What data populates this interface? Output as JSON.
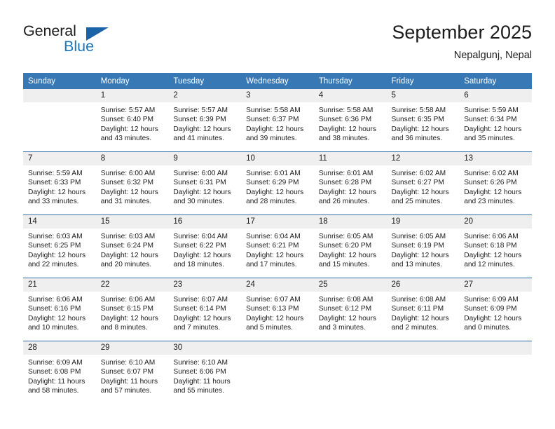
{
  "logo": {
    "text_top": "General",
    "text_bottom": "Blue",
    "triangle_color": "#1b63a8",
    "blue_color": "#1b75bb"
  },
  "header": {
    "title": "September 2025",
    "subtitle": "Nepalgunj, Nepal"
  },
  "theme": {
    "header_row_bg": "#3878b4",
    "day_number_bg": "#efefef",
    "week_divider": "#2f6eaa"
  },
  "weekday_headers": [
    "Sunday",
    "Monday",
    "Tuesday",
    "Wednesday",
    "Thursday",
    "Friday",
    "Saturday"
  ],
  "weeks": [
    [
      {
        "day": "",
        "empty": true
      },
      {
        "day": "1",
        "sunrise": "Sunrise: 5:57 AM",
        "sunset": "Sunset: 6:40 PM",
        "daylight_1": "Daylight: 12 hours",
        "daylight_2": "and 43 minutes."
      },
      {
        "day": "2",
        "sunrise": "Sunrise: 5:57 AM",
        "sunset": "Sunset: 6:39 PM",
        "daylight_1": "Daylight: 12 hours",
        "daylight_2": "and 41 minutes."
      },
      {
        "day": "3",
        "sunrise": "Sunrise: 5:58 AM",
        "sunset": "Sunset: 6:37 PM",
        "daylight_1": "Daylight: 12 hours",
        "daylight_2": "and 39 minutes."
      },
      {
        "day": "4",
        "sunrise": "Sunrise: 5:58 AM",
        "sunset": "Sunset: 6:36 PM",
        "daylight_1": "Daylight: 12 hours",
        "daylight_2": "and 38 minutes."
      },
      {
        "day": "5",
        "sunrise": "Sunrise: 5:58 AM",
        "sunset": "Sunset: 6:35 PM",
        "daylight_1": "Daylight: 12 hours",
        "daylight_2": "and 36 minutes."
      },
      {
        "day": "6",
        "sunrise": "Sunrise: 5:59 AM",
        "sunset": "Sunset: 6:34 PM",
        "daylight_1": "Daylight: 12 hours",
        "daylight_2": "and 35 minutes."
      }
    ],
    [
      {
        "day": "7",
        "sunrise": "Sunrise: 5:59 AM",
        "sunset": "Sunset: 6:33 PM",
        "daylight_1": "Daylight: 12 hours",
        "daylight_2": "and 33 minutes."
      },
      {
        "day": "8",
        "sunrise": "Sunrise: 6:00 AM",
        "sunset": "Sunset: 6:32 PM",
        "daylight_1": "Daylight: 12 hours",
        "daylight_2": "and 31 minutes."
      },
      {
        "day": "9",
        "sunrise": "Sunrise: 6:00 AM",
        "sunset": "Sunset: 6:31 PM",
        "daylight_1": "Daylight: 12 hours",
        "daylight_2": "and 30 minutes."
      },
      {
        "day": "10",
        "sunrise": "Sunrise: 6:01 AM",
        "sunset": "Sunset: 6:29 PM",
        "daylight_1": "Daylight: 12 hours",
        "daylight_2": "and 28 minutes."
      },
      {
        "day": "11",
        "sunrise": "Sunrise: 6:01 AM",
        "sunset": "Sunset: 6:28 PM",
        "daylight_1": "Daylight: 12 hours",
        "daylight_2": "and 26 minutes."
      },
      {
        "day": "12",
        "sunrise": "Sunrise: 6:02 AM",
        "sunset": "Sunset: 6:27 PM",
        "daylight_1": "Daylight: 12 hours",
        "daylight_2": "and 25 minutes."
      },
      {
        "day": "13",
        "sunrise": "Sunrise: 6:02 AM",
        "sunset": "Sunset: 6:26 PM",
        "daylight_1": "Daylight: 12 hours",
        "daylight_2": "and 23 minutes."
      }
    ],
    [
      {
        "day": "14",
        "sunrise": "Sunrise: 6:03 AM",
        "sunset": "Sunset: 6:25 PM",
        "daylight_1": "Daylight: 12 hours",
        "daylight_2": "and 22 minutes."
      },
      {
        "day": "15",
        "sunrise": "Sunrise: 6:03 AM",
        "sunset": "Sunset: 6:24 PM",
        "daylight_1": "Daylight: 12 hours",
        "daylight_2": "and 20 minutes."
      },
      {
        "day": "16",
        "sunrise": "Sunrise: 6:04 AM",
        "sunset": "Sunset: 6:22 PM",
        "daylight_1": "Daylight: 12 hours",
        "daylight_2": "and 18 minutes."
      },
      {
        "day": "17",
        "sunrise": "Sunrise: 6:04 AM",
        "sunset": "Sunset: 6:21 PM",
        "daylight_1": "Daylight: 12 hours",
        "daylight_2": "and 17 minutes."
      },
      {
        "day": "18",
        "sunrise": "Sunrise: 6:05 AM",
        "sunset": "Sunset: 6:20 PM",
        "daylight_1": "Daylight: 12 hours",
        "daylight_2": "and 15 minutes."
      },
      {
        "day": "19",
        "sunrise": "Sunrise: 6:05 AM",
        "sunset": "Sunset: 6:19 PM",
        "daylight_1": "Daylight: 12 hours",
        "daylight_2": "and 13 minutes."
      },
      {
        "day": "20",
        "sunrise": "Sunrise: 6:06 AM",
        "sunset": "Sunset: 6:18 PM",
        "daylight_1": "Daylight: 12 hours",
        "daylight_2": "and 12 minutes."
      }
    ],
    [
      {
        "day": "21",
        "sunrise": "Sunrise: 6:06 AM",
        "sunset": "Sunset: 6:16 PM",
        "daylight_1": "Daylight: 12 hours",
        "daylight_2": "and 10 minutes."
      },
      {
        "day": "22",
        "sunrise": "Sunrise: 6:06 AM",
        "sunset": "Sunset: 6:15 PM",
        "daylight_1": "Daylight: 12 hours",
        "daylight_2": "and 8 minutes."
      },
      {
        "day": "23",
        "sunrise": "Sunrise: 6:07 AM",
        "sunset": "Sunset: 6:14 PM",
        "daylight_1": "Daylight: 12 hours",
        "daylight_2": "and 7 minutes."
      },
      {
        "day": "24",
        "sunrise": "Sunrise: 6:07 AM",
        "sunset": "Sunset: 6:13 PM",
        "daylight_1": "Daylight: 12 hours",
        "daylight_2": "and 5 minutes."
      },
      {
        "day": "25",
        "sunrise": "Sunrise: 6:08 AM",
        "sunset": "Sunset: 6:12 PM",
        "daylight_1": "Daylight: 12 hours",
        "daylight_2": "and 3 minutes."
      },
      {
        "day": "26",
        "sunrise": "Sunrise: 6:08 AM",
        "sunset": "Sunset: 6:11 PM",
        "daylight_1": "Daylight: 12 hours",
        "daylight_2": "and 2 minutes."
      },
      {
        "day": "27",
        "sunrise": "Sunrise: 6:09 AM",
        "sunset": "Sunset: 6:09 PM",
        "daylight_1": "Daylight: 12 hours",
        "daylight_2": "and 0 minutes."
      }
    ],
    [
      {
        "day": "28",
        "sunrise": "Sunrise: 6:09 AM",
        "sunset": "Sunset: 6:08 PM",
        "daylight_1": "Daylight: 11 hours",
        "daylight_2": "and 58 minutes."
      },
      {
        "day": "29",
        "sunrise": "Sunrise: 6:10 AM",
        "sunset": "Sunset: 6:07 PM",
        "daylight_1": "Daylight: 11 hours",
        "daylight_2": "and 57 minutes."
      },
      {
        "day": "30",
        "sunrise": "Sunrise: 6:10 AM",
        "sunset": "Sunset: 6:06 PM",
        "daylight_1": "Daylight: 11 hours",
        "daylight_2": "and 55 minutes."
      },
      {
        "day": "",
        "empty": true
      },
      {
        "day": "",
        "empty": true
      },
      {
        "day": "",
        "empty": true
      },
      {
        "day": "",
        "empty": true
      }
    ]
  ]
}
